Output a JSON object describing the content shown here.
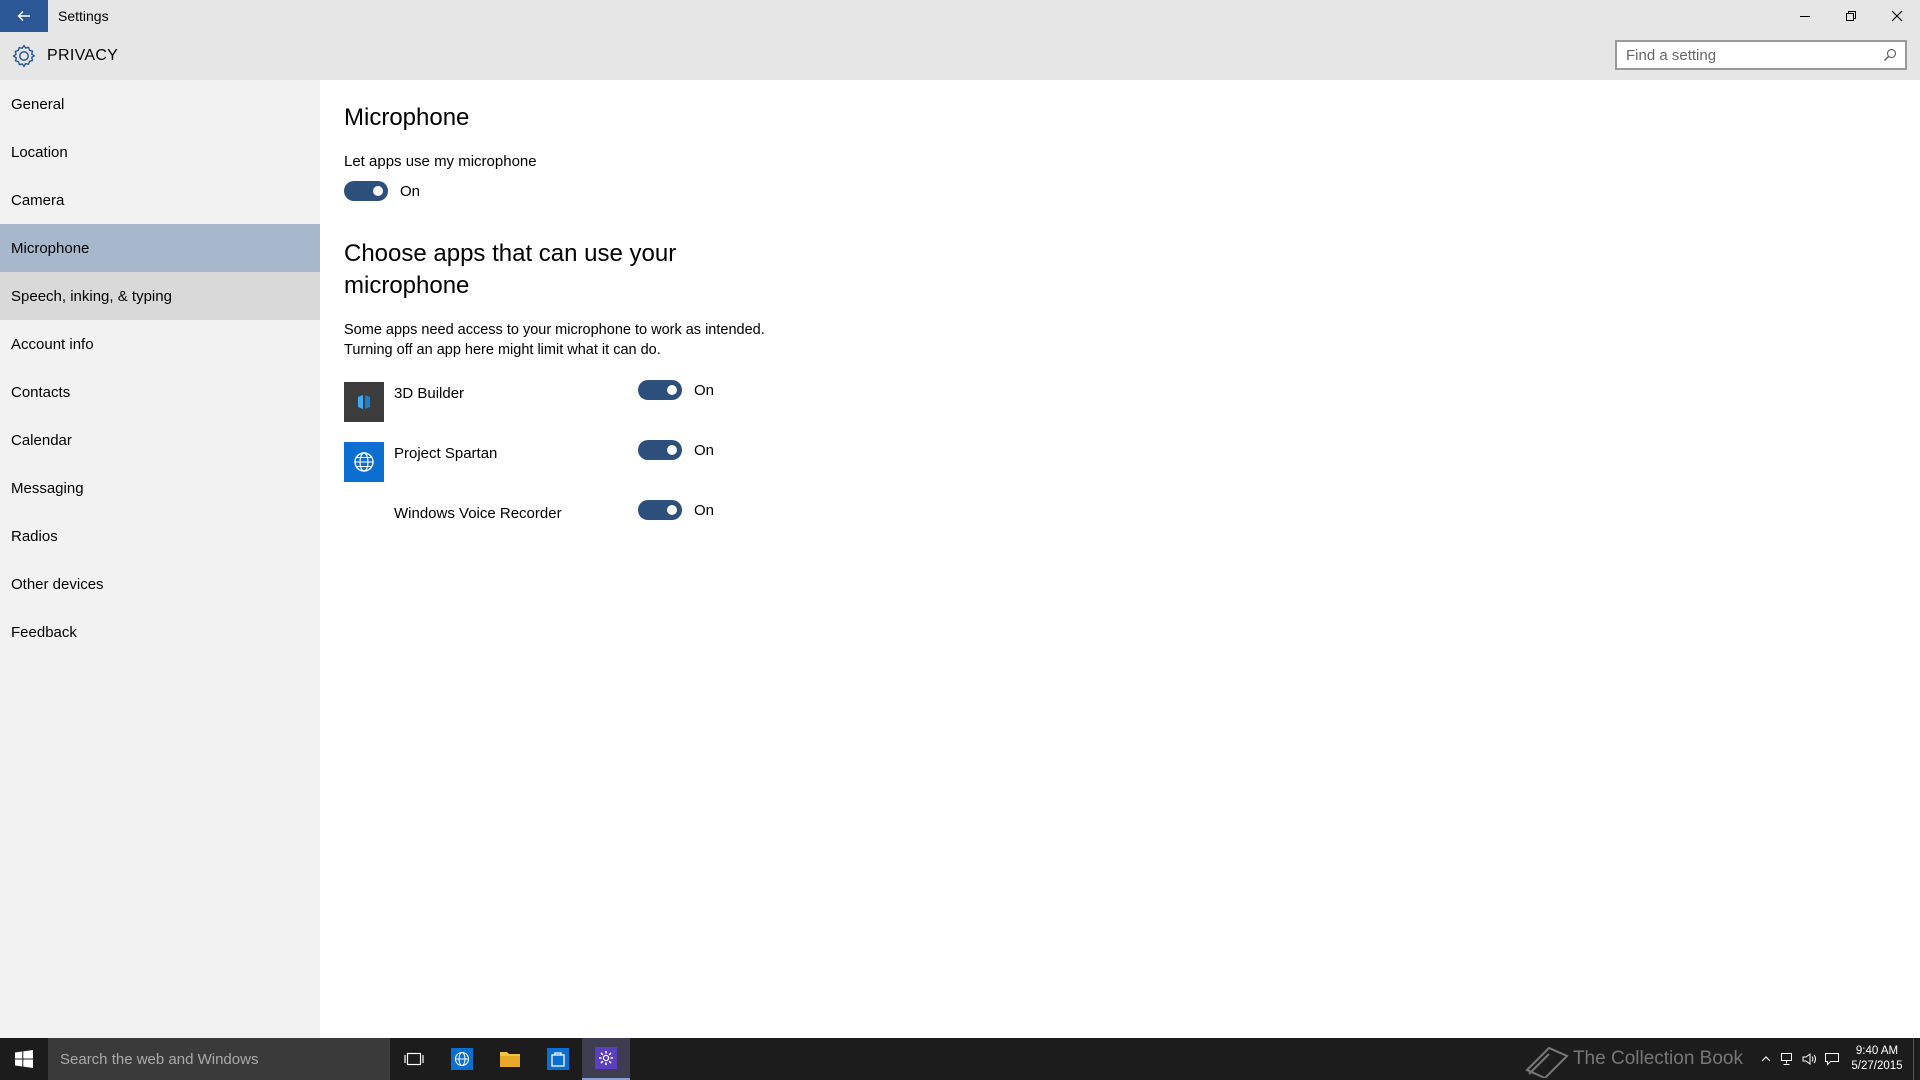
{
  "window": {
    "title": "Settings"
  },
  "header": {
    "title": "PRIVACY",
    "search_placeholder": "Find a setting"
  },
  "sidebar": {
    "items": [
      {
        "label": "General"
      },
      {
        "label": "Location"
      },
      {
        "label": "Camera"
      },
      {
        "label": "Microphone"
      },
      {
        "label": "Speech, inking, & typing"
      },
      {
        "label": "Account info"
      },
      {
        "label": "Contacts"
      },
      {
        "label": "Calendar"
      },
      {
        "label": "Messaging"
      },
      {
        "label": "Radios"
      },
      {
        "label": "Other devices"
      },
      {
        "label": "Feedback"
      }
    ],
    "selected": "Microphone"
  },
  "main": {
    "title": "Microphone",
    "master_label": "Let apps use my microphone",
    "master_state": "On",
    "apps_title_line1": "Choose apps that can use your",
    "apps_title_line2": "microphone",
    "desc_line1": "Some apps need access to your microphone to work as intended.",
    "desc_line2": "Turning off an app here might limit what it can do.",
    "apps": [
      {
        "name": "3D Builder",
        "state": "On",
        "tile_color": "#3c3c3c"
      },
      {
        "name": "Project Spartan",
        "state": "On",
        "tile_color": "#0a6fd0"
      },
      {
        "name": "Windows Voice Recorder",
        "state": "On"
      }
    ]
  },
  "taskbar": {
    "search_placeholder": "Search the web and Windows",
    "watermark": "The Collection Book",
    "time": "9:40 AM",
    "date": "5/27/2015"
  },
  "colors": {
    "accent": "#2b5797",
    "toggle_on": "#2d4f7c",
    "selected_nav": "#a7b8cd"
  }
}
